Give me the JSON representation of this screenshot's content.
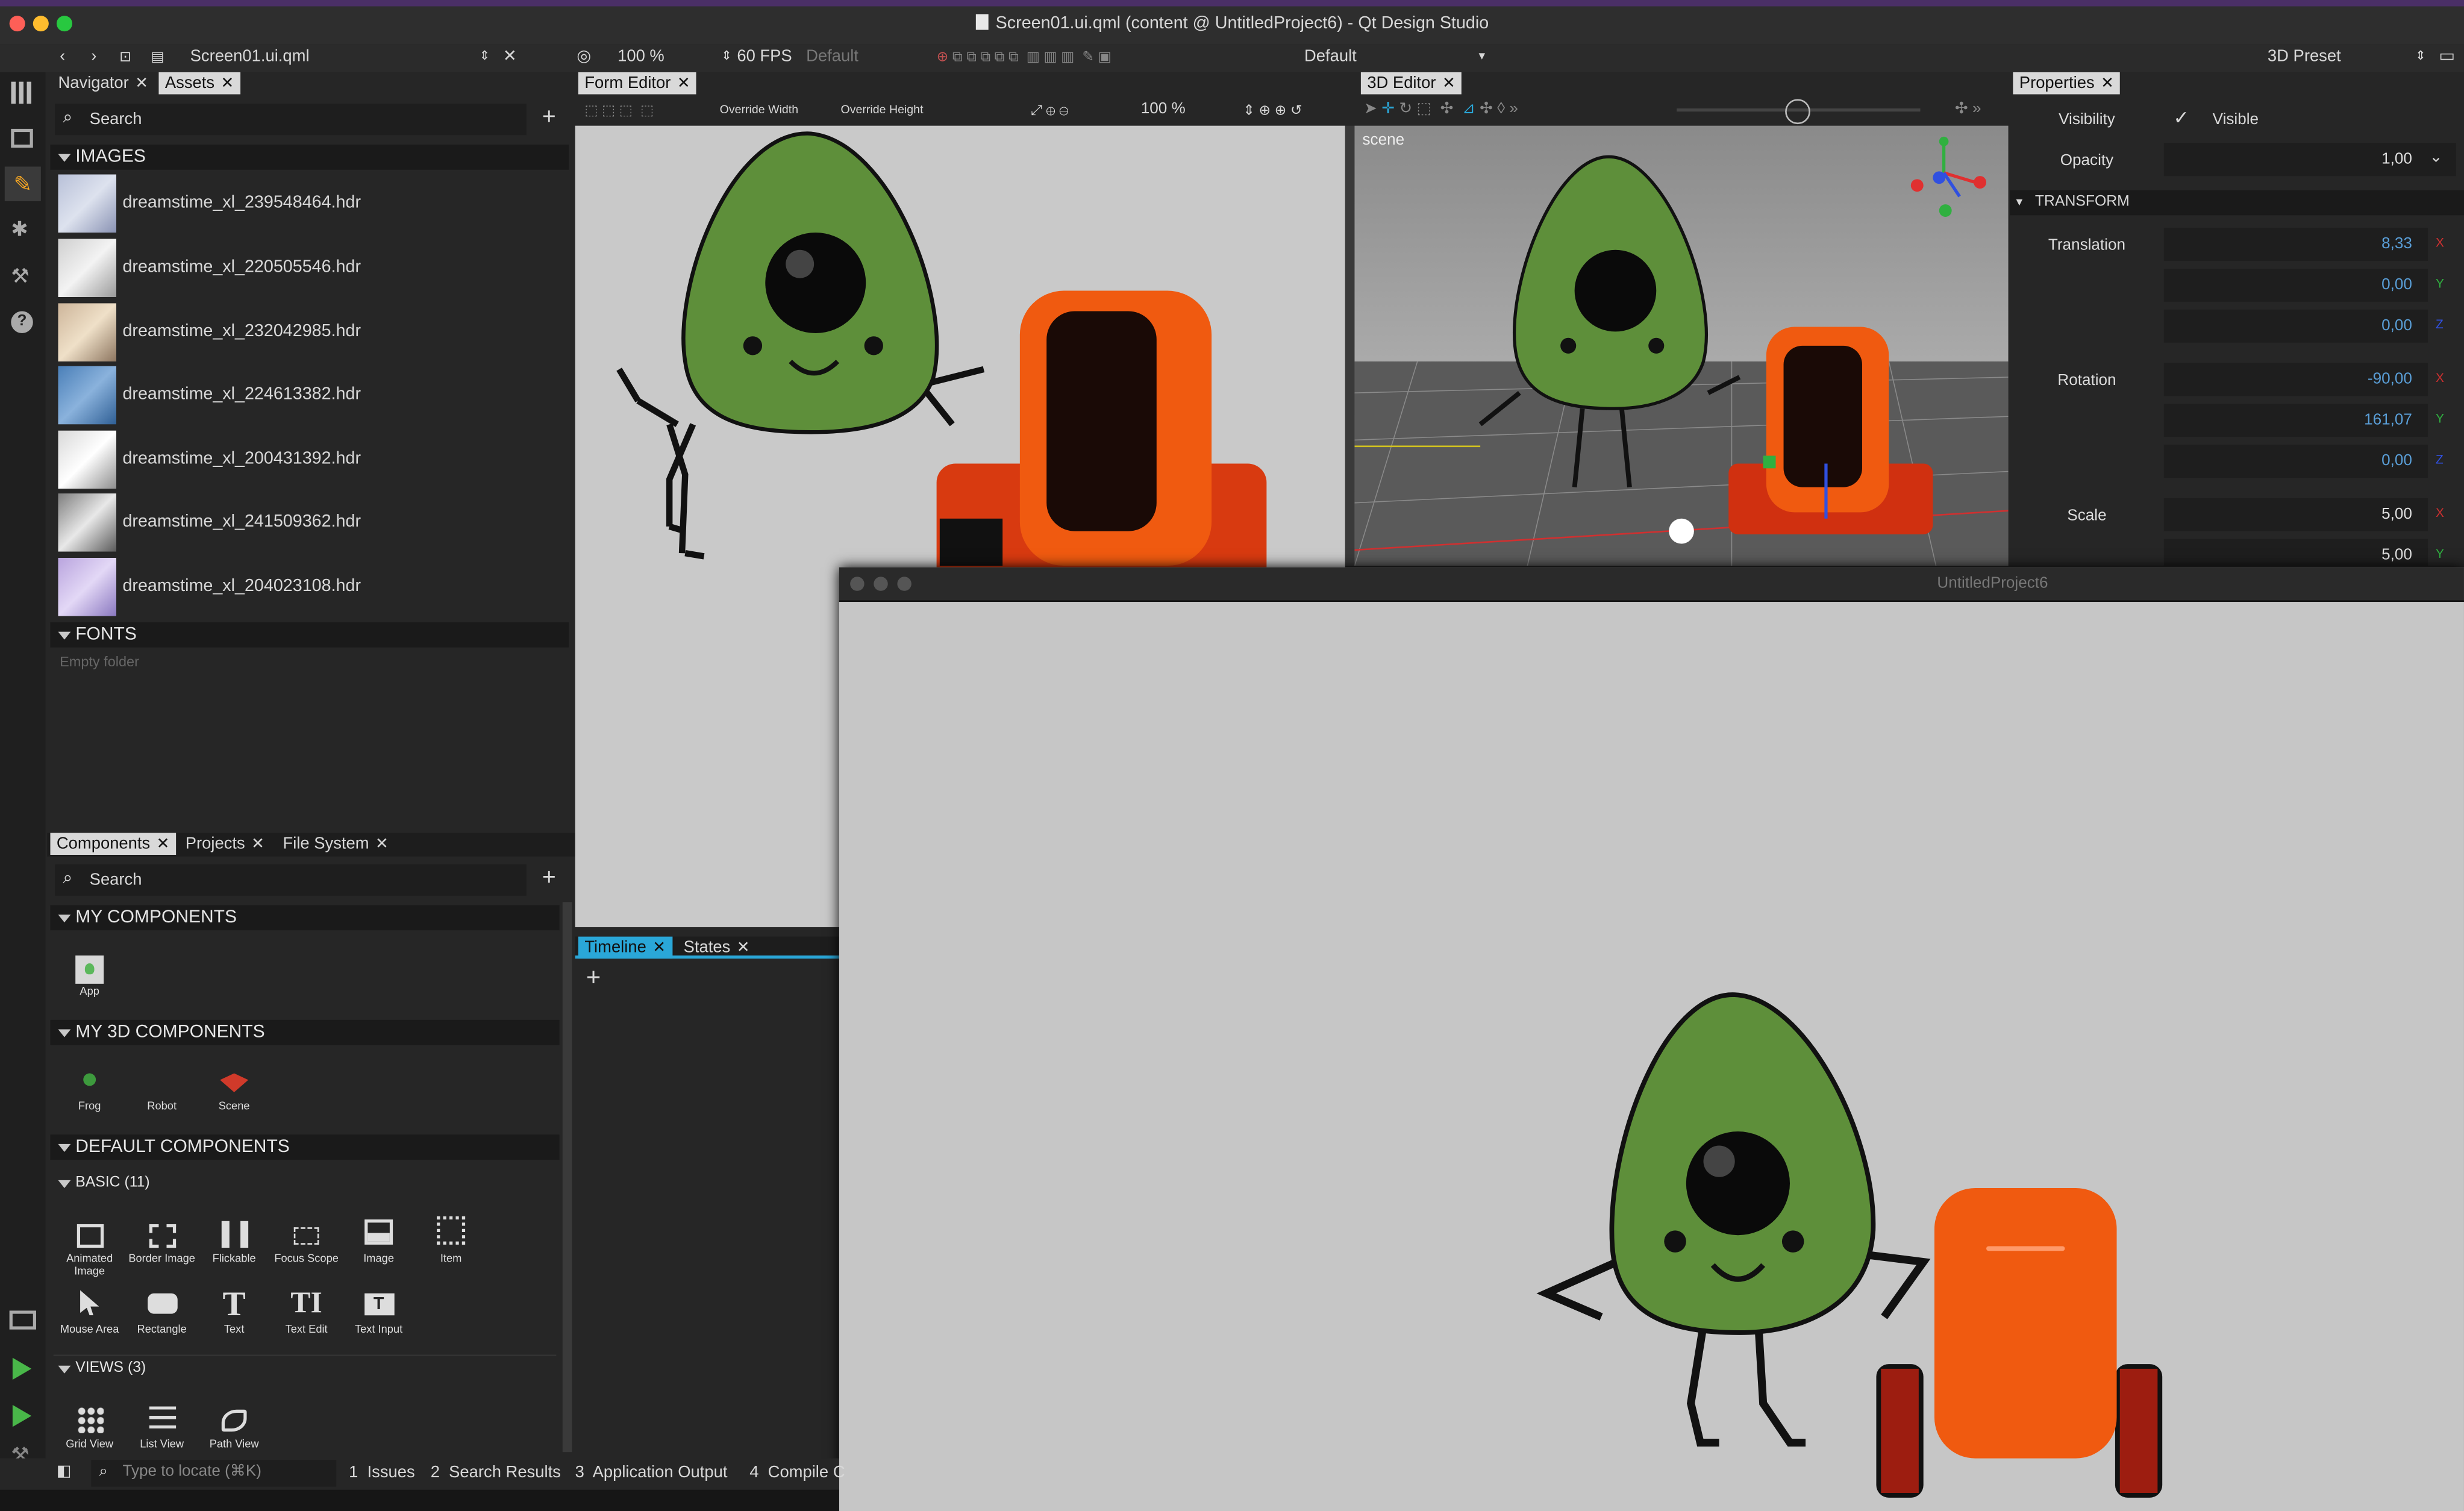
{
  "window": {
    "title": "Screen01.ui.qml (content @ UntitledProject6) - Qt Design Studio"
  },
  "toolbar": {
    "file_name": "Screen01.ui.qml",
    "zoom": "100 %",
    "fps": "60 FPS",
    "style": "Default",
    "theme": "Default",
    "preset": "3D Preset"
  },
  "left_tabs": {
    "navigator": "Navigator",
    "assets": "Assets"
  },
  "assets": {
    "search_placeholder": "Search",
    "images_header": "IMAGES",
    "images": [
      {
        "name": "dreamstime_xl_239548464.hdr"
      },
      {
        "name": "dreamstime_xl_220505546.hdr"
      },
      {
        "name": "dreamstime_xl_232042985.hdr"
      },
      {
        "name": "dreamstime_xl_224613382.hdr"
      },
      {
        "name": "dreamstime_xl_200431392.hdr"
      },
      {
        "name": "dreamstime_xl_241509362.hdr"
      },
      {
        "name": "dreamstime_xl_204023108.hdr"
      }
    ],
    "fonts_header": "FONTS",
    "fonts_empty": "Empty folder"
  },
  "lib_tabs": {
    "components": "Components",
    "projects": "Projects",
    "file_system": "File System"
  },
  "components": {
    "search_placeholder": "Search",
    "my_components": "MY COMPONENTS",
    "my_items": [
      {
        "label": "App"
      }
    ],
    "my_3d": "MY 3D COMPONENTS",
    "my_3d_items": [
      {
        "label": "Frog"
      },
      {
        "label": "Robot"
      },
      {
        "label": "Scene"
      }
    ],
    "default": "DEFAULT COMPONENTS",
    "basic": "BASIC (11)",
    "basic_items": [
      {
        "label": "Animated Image"
      },
      {
        "label": "Border Image"
      },
      {
        "label": "Flickable"
      },
      {
        "label": "Focus Scope"
      },
      {
        "label": "Image"
      },
      {
        "label": "Item"
      },
      {
        "label": "Mouse Area"
      },
      {
        "label": "Rectangle"
      },
      {
        "label": "Text"
      },
      {
        "label": "Text Edit"
      },
      {
        "label": "Text Input"
      }
    ],
    "views": "VIEWS (3)",
    "views_items": [
      {
        "label": "Grid View"
      },
      {
        "label": "List View"
      },
      {
        "label": "Path View"
      }
    ]
  },
  "form_editor": {
    "tab": "Form Editor",
    "override_width": "Override Width",
    "override_height": "Override Height",
    "zoom": "100 %"
  },
  "editor3d": {
    "tab": "3D Editor",
    "scene_label": "scene"
  },
  "timeline": {
    "tab": "Timeline",
    "states_tab": "States"
  },
  "preview": {
    "title": "UntitledProject6"
  },
  "properties": {
    "tab": "Properties",
    "visibility_label": "Visibility",
    "visible_text": "Visible",
    "opacity_label": "Opacity",
    "opacity": "1,00",
    "transform_header": "TRANSFORM",
    "translation_label": "Translation",
    "translation": [
      "8,33",
      "0,00",
      "0,00"
    ],
    "rotation_label": "Rotation",
    "rotation": [
      "-90,00",
      "161,07",
      "0,00"
    ],
    "scale_label": "Scale",
    "scale": [
      "5,00",
      "5,00"
    ],
    "axes": [
      "X",
      "Y",
      "Z"
    ]
  },
  "statusbar": {
    "locate_placeholder": "Type to locate (⌘K)",
    "items": [
      "1  Issues",
      "2  Search Results",
      "3  Application Output",
      "4  Compile C"
    ]
  },
  "colors": {
    "accent": "#2aa7d8",
    "avocado": "#5e8f3a",
    "robot": "#f05a10",
    "axis_x": "#e03030",
    "axis_y": "#30b040",
    "axis_z": "#3050e0"
  }
}
